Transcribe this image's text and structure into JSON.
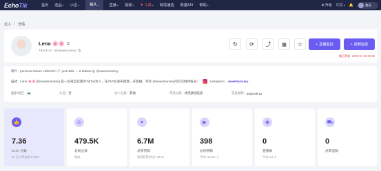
{
  "brand": {
    "logo_prefix": "Echo",
    "logo_suffix": "Tik"
  },
  "nav": {
    "items": [
      {
        "label": "首页",
        "caret": false
      },
      {
        "label": "选品",
        "caret": true
      },
      {
        "label": "小店",
        "caret": true
      },
      {
        "label": "达人",
        "caret": true,
        "active": true
      },
      {
        "label": "直播",
        "caret": true
      },
      {
        "label": "视频",
        "caret": true
      },
      {
        "label": "工具",
        "caret": true,
        "tools": true
      },
      {
        "label": "跨境通选",
        "caret": false
      },
      {
        "label": "数据API",
        "caret": false
      },
      {
        "label": "帮助",
        "caret": true
      }
    ],
    "upgrade": "升级",
    "language": "中文",
    "account": "会员"
  },
  "breadcrumb": {
    "root": "达人",
    "sep": "/",
    "current": "详情"
  },
  "profile": {
    "name": "Lena 🌸🌸",
    "handle": "TikTok ID : @sweetnursery",
    "updated": "最后更新: 2025-01-20 00:18",
    "buttons": {
      "add_live": "直播监控",
      "add_video": "视频监控"
    }
  },
  "info": {
    "bio": "简介 : personal reborn collection 🤍 just dolls → 6 babies ig: @sweetnursery",
    "desc": "描述 : Lena 🌸🌸(@sweetnursery) 是一位来自巴西的TikTok达人，在TikTok发布视频，开直播，带货 @sweetnursery的社交媒体账号：",
    "instagram_label": "Instagram:",
    "instagram_handle": "sweetnursery",
    "meta": [
      {
        "label": "国家/地区 :",
        "value": "",
        "flag": true
      },
      {
        "label": "认证 :",
        "value": "否"
      },
      {
        "label": "达人分类 :",
        "value": "其他"
      },
      {
        "label": "带货分类 :",
        "value": "尚无类别信息"
      },
      {
        "label": "首发视频 :",
        "value": "2022-09-11"
      }
    ]
  },
  "stats": [
    {
      "icon": "👍",
      "icon_name": "thumbs-up-icon",
      "value": "7.36",
      "label": "Echo 分数",
      "sub": "63 正分率击败 6.09%",
      "highlight": true
    },
    {
      "icon": "◎",
      "icon_name": "followers-icon",
      "value": "479.5K",
      "label": "总粉丝数",
      "sub": "播放"
    },
    {
      "icon": "♥",
      "icon_name": "heart-icon",
      "value": "6.7M",
      "label": "总获赞数",
      "sub": "视频获赞/粉丝: 13.91"
    },
    {
      "icon": "▶",
      "icon_name": "video-icon",
      "value": "398",
      "label": "总视频数",
      "sub": "平均 123.2K 人"
    },
    {
      "icon": "◉",
      "icon_name": "live-icon",
      "value": "0",
      "label": "直播数",
      "sub": "平均 0.0 人"
    },
    {
      "icon": "⛟",
      "icon_name": "product-icon",
      "value": "0",
      "label": "总商品数",
      "sub": ""
    }
  ]
}
